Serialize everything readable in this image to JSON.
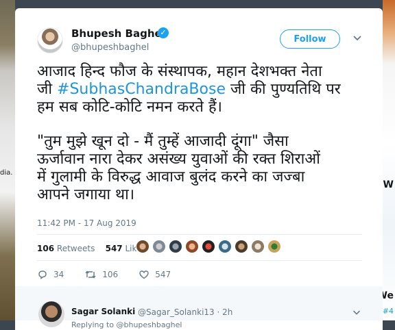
{
  "background": {
    "left_text": "dia.",
    "right_w1": "W",
    "right_w2": "We",
    "right_hashtag": "#4"
  },
  "tweet": {
    "author_name": "Bhupesh Baghel",
    "handle": "@bhupeshbaghel",
    "follow_label": "Follow",
    "text_line1": "आजाद हिन्द फौज के संस्थापक, महान देशभक्त नेता",
    "text_line2_prefix": "जी ",
    "hashtag": "#SubhasChandraBose",
    "text_line2_suffix": " जी की पुण्यतिथि पर",
    "text_line3": "हम सब कोटि-कोटि नमन करते हैं।",
    "text_para2_line1": "\"तुम मुझे खून दो - मैं तुम्हें आजादी दूंगा\" जैसा",
    "text_para2_line2": "ऊर्जावान नारा देकर असंख्य युवाओं की रक्त शिराओं",
    "text_para2_line3": "में गुलामी के विरुद्ध आवाज बुलंद करने का जज्बा",
    "text_para2_line4": "आपने जगाया था।",
    "timestamp": "11:42 PM - 17 Aug 2019",
    "retweets_count": "106",
    "retweets_label": "Retweets",
    "likes_count": "547",
    "likes_label": "Likes",
    "reply_count": "34",
    "retweet_action_count": "106",
    "like_action_count": "547"
  },
  "reply": {
    "name": "Sagar Solanki",
    "handle_time": "@Sagar_Solanki13 · 2h",
    "subtext": "Replying to @bhupeshbaghel"
  },
  "colors": {
    "accent": "#1da1f2",
    "text": "#14171a",
    "muted": "#657786",
    "page_bg": "#3b4650"
  }
}
